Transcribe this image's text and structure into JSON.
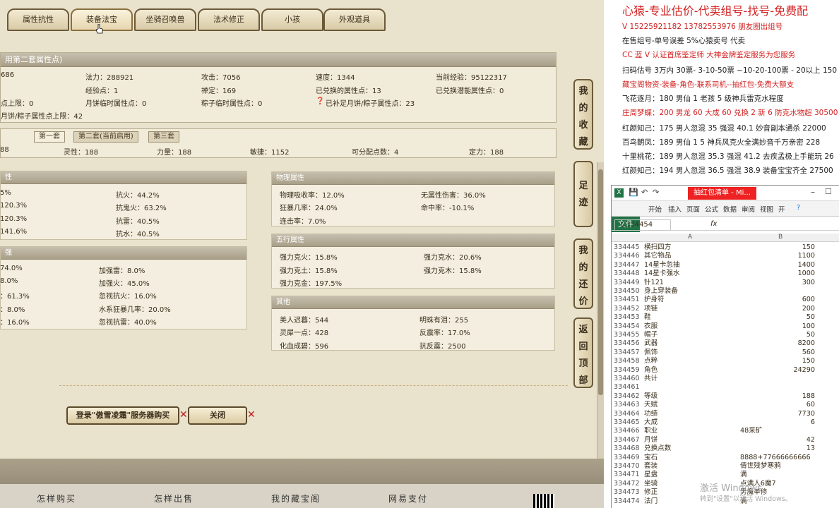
{
  "tabs": [
    "属性抗性",
    "装备法宝",
    "坐骑召唤兽",
    "法术修正",
    "小孩",
    "外观道具"
  ],
  "top_panel": {
    "header": "用第二套属性点)",
    "rows": [
      [
        "686",
        "法力：288921",
        "攻击：7056",
        "速度：1344",
        "当前经验：95122317"
      ],
      [
        "",
        "经验点：1",
        "禅定：169",
        "已兑换的属性点：13",
        "已兑换潜能属性点：0"
      ],
      [
        "点上限：0",
        "月饼临时属性点：0",
        "粽子临时属性点：0",
        "已补足月饼/粽子属性点：23",
        ""
      ],
      [
        "月饼/粽子属性点上限：42",
        "",
        "",
        "",
        ""
      ]
    ]
  },
  "sub_tabs": [
    "第一套",
    "第二套(当前启用)",
    "第三套"
  ],
  "attr_row": [
    "88",
    "灵性：188",
    "力量：188",
    "敏捷：1152",
    "可分配点数：4",
    "定力：188"
  ],
  "left_box1": {
    "header": "性",
    "cells": [
      [
        "5%",
        "抗火：44.2%"
      ],
      [
        "120.3%",
        "抗鬼火：63.2%"
      ],
      [
        "120.3%",
        "抗雷：40.5%"
      ],
      [
        "141.6%",
        "抗水：40.5%"
      ]
    ]
  },
  "left_box2": {
    "header": "强",
    "cells": [
      [
        "74.0%",
        "加强雷：8.0%"
      ],
      [
        "8.0%",
        "加强火：45.0%"
      ],
      [
        "：61.3%",
        "忽视抗火：16.0%"
      ],
      [
        "：8.0%",
        "水系狂暴几率：20.0%"
      ],
      [
        "：16.0%",
        "忽视抗雷：40.0%"
      ]
    ]
  },
  "phys_box": {
    "header": "物理属性",
    "cells": [
      [
        "物理吸收率：12.0%",
        "无属性伤害：36.0%"
      ],
      [
        "狂暴几率：24.0%",
        "命中率：-10.1%"
      ],
      [
        "连击率：7.0%",
        ""
      ]
    ]
  },
  "wuxing_box": {
    "header": "五行属性",
    "cells": [
      [
        "强力克火：15.8%",
        "强力克水：20.6%"
      ],
      [
        "强力克土：15.8%",
        "强力克木：15.8%"
      ],
      [
        "强力克金：197.5%",
        ""
      ]
    ]
  },
  "other_box": {
    "header": "其他",
    "cells": [
      [
        "美人迟暮：544",
        "明珠有泪：255"
      ],
      [
        "灵犀一点：428",
        "反震率：17.0%"
      ],
      [
        "化血成碧：596",
        "抗反震：2500"
      ]
    ]
  },
  "side_buttons": [
    [
      "我",
      "的",
      "收",
      "藏"
    ],
    [
      "足",
      "迹"
    ],
    [
      "我",
      "的",
      "还",
      "价"
    ],
    [
      "返",
      "回",
      "顶",
      "部"
    ]
  ],
  "buttons": {
    "login": "登录\"傲雪凌霜\"服务器购买",
    "close": "关闭"
  },
  "footer": [
    "怎样购买",
    "怎样出售",
    "我的藏宝阁",
    "网易支付"
  ],
  "right_panel": {
    "lines": [
      {
        "text": "心猿-专业估价-代卖组号-找号-免费配",
        "color": "#d32020",
        "big": true
      },
      {
        "text": "V 15225921182   13782553976 朋友圈出组号",
        "color": "#d32020",
        "big": false
      },
      {
        "text": "在售组号-单号误差 5%心猿卖号 代卖",
        "color": "#222222",
        "big": false
      },
      {
        "text": "CC 蓝 V 认证首席鉴定师 大神金牌鉴定服务为您服务",
        "color": "#d32020",
        "big": false
      },
      {
        "text": "扫码估号 3万内 30票- 3-10-50票 ~10-20-100票 - 20以上 150",
        "color": "#222222",
        "big": false
      },
      {
        "text": "藏宝阁物资-装备-角色-联系司机--抽红包-免费大额支",
        "color": "#d32020",
        "big": false
      },
      {
        "text": "飞花逐月：180 男仙 1 老孩 5 级神兵雷克水程度",
        "color": "#222222",
        "big": false
      },
      {
        "text": "庄周梦蝶：200 男龙 60 大成 60 兑换 2 新 6 防克水物超 30500",
        "color": "#d32020",
        "big": false
      },
      {
        "text": "红颜知己：175 男人忽混 35 强混 40.1 妙音副本通杀 22000",
        "color": "#222222",
        "big": false
      },
      {
        "text": "百鸟朝凤：189 男仙 1 5 神兵风克火全满妙音千万亲密 228",
        "color": "#222222",
        "big": false
      },
      {
        "text": "十里桃花：189 男人忽混 35.3 强混 41.2 去疾孟极上手能玩 26",
        "color": "#222222",
        "big": false
      },
      {
        "text": "红颜知己：194 男人忽混 36.5 强混 38.9 装备宝宝齐全 27500",
        "color": "#222222",
        "big": false
      }
    ]
  },
  "excel": {
    "title": "抽红包清单 - Mi...",
    "ribbon_tabs": [
      "文件",
      "开始",
      "插入",
      "页面",
      "公式",
      "数据",
      "审阅",
      "视图",
      "开"
    ],
    "name_box": "C334454",
    "fx": "fx",
    "col_a": "A",
    "col_b": "B",
    "rows": [
      [
        "334445",
        "横扫四方",
        "150"
      ],
      [
        "334446",
        "其它物品",
        "1100"
      ],
      [
        "334447",
        "14星卡忽抽",
        "1400"
      ],
      [
        "334448",
        "14星卡强水",
        "1000"
      ],
      [
        "334449",
        "针121",
        "300"
      ],
      [
        "334450",
        "身上穿装备",
        ""
      ],
      [
        "334451",
        "护身符",
        "600"
      ],
      [
        "334452",
        "项链",
        "200"
      ],
      [
        "334453",
        "鞋",
        "50"
      ],
      [
        "334454",
        "衣服",
        "100"
      ],
      [
        "334455",
        "帽子",
        "50"
      ],
      [
        "334456",
        "武器",
        "8200"
      ],
      [
        "334457",
        "佩饰",
        "560"
      ],
      [
        "334458",
        "点粹",
        "150"
      ],
      [
        "334459",
        "角色",
        "24290"
      ],
      [
        "334460",
        "共计",
        ""
      ],
      [
        "334461",
        "",
        ""
      ],
      [
        "334462",
        "等级",
        "188"
      ],
      [
        "334463",
        "天赋",
        "60"
      ],
      [
        "334464",
        "功绩",
        "7730"
      ],
      [
        "334465",
        "大成",
        "6"
      ],
      [
        "334466",
        "职业",
        "48采矿"
      ],
      [
        "334467",
        "月饼",
        "42"
      ],
      [
        "334468",
        "兑换点数",
        "13"
      ],
      [
        "334469",
        "宝石",
        "8888+77666666666"
      ],
      [
        "334470",
        "套装",
        "倩世残梦寒鸦"
      ],
      [
        "334471",
        "星盘",
        "满"
      ],
      [
        "334472",
        "坐骑",
        "点满人6魔7"
      ],
      [
        "334473",
        "修正",
        "男魔单修"
      ],
      [
        "334474",
        "法门",
        "满"
      ]
    ],
    "watermark": "激活 Windows",
    "watermark2": "转到\"设置\"以激活 Windows。"
  }
}
